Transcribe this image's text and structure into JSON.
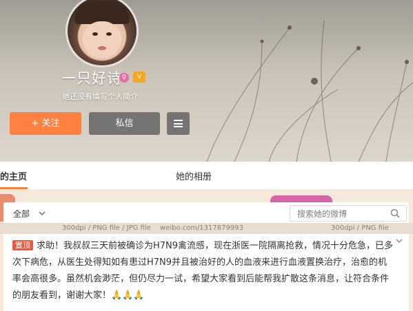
{
  "profile": {
    "username": "一只好诗",
    "bio": "她还没有填写个人简介",
    "badges": {
      "gender": "♀",
      "vip": "V"
    }
  },
  "actions": {
    "follow_label": "+ 关注",
    "message_label": "私信"
  },
  "tabs": [
    {
      "label": "的主页"
    },
    {
      "label": "她的相册"
    }
  ],
  "watermark": {
    "left": "300dpi / PNG file / JPG file",
    "center": "weibo.com/1317879993",
    "right": "300dpi / PNG file"
  },
  "filter": {
    "label": "全部",
    "search_placeholder": "搜索她的微博"
  },
  "post": {
    "pin_label": "置顶",
    "text": "求助！我叔叔三天前被确诊为H7N9禽流感，现在浙医一院隔离抢救，情况十分危急，已多次下病危，从医生处得知如有患过H7N9并且被治好的人的血液来进行血液置换治疗，治愈的机率会高很多。虽然机会渺茫，但仍尽力一试，希望大家看到后能帮我扩散这条消息，让符合条件的朋友看到，谢谢大家！",
    "emoji": "🙏🙏🙏"
  },
  "colors": {
    "accent": "#ff8140",
    "pin": "#eb5a3e",
    "button_dark": "#6d6d6d"
  }
}
